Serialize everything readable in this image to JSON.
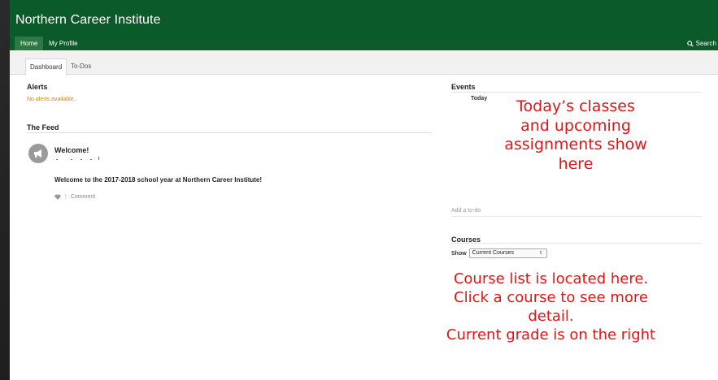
{
  "header": {
    "school_name": "Northern Career Institute",
    "nav": {
      "home": "Home",
      "my_profile": "My Profile",
      "search": "Search"
    },
    "colors": {
      "bar": "#0b5a2a",
      "active_nav": "#2c7a43"
    }
  },
  "tabs": {
    "dashboard": "Dashboard",
    "todos": "To-Dos"
  },
  "alerts": {
    "heading": "Alerts",
    "empty_message": "No alerts available."
  },
  "feed": {
    "heading": "The Feed",
    "post": {
      "title": "Welcome!",
      "body": "Welcome to the 2017-2018 school year at Northern Career Institute!",
      "comment_label": "Comment",
      "separator": "|",
      "icon": "megaphone-icon",
      "like_icon": "heart-icon"
    }
  },
  "events": {
    "heading": "Events",
    "today_label": "Today"
  },
  "todo": {
    "add_placeholder": "Add a to-do"
  },
  "courses": {
    "heading": "Courses",
    "show_label": "Show",
    "filter_selected": "Current Courses",
    "filter_chevron": "⇕"
  },
  "annotations": {
    "top": [
      "Today’s classes",
      "and upcoming",
      "assignments show",
      "here"
    ],
    "bottom": [
      "Course list is located here.",
      "Click a course to see more",
      "detail.",
      "Current grade is on the right"
    ],
    "color": "#e01616"
  }
}
